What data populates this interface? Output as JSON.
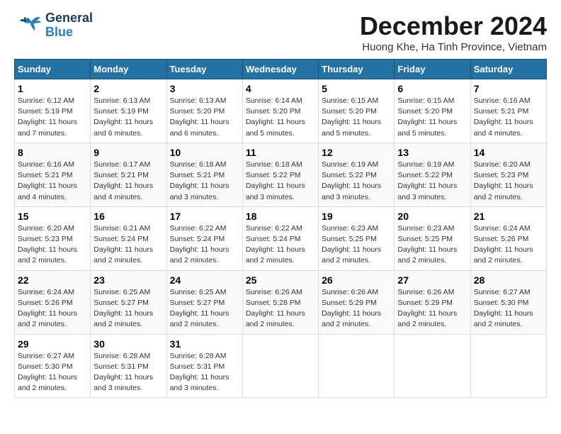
{
  "header": {
    "logo_general": "General",
    "logo_blue": "Blue",
    "title": "December 2024",
    "location": "Huong Khe, Ha Tinh Province, Vietnam"
  },
  "days_of_week": [
    "Sunday",
    "Monday",
    "Tuesday",
    "Wednesday",
    "Thursday",
    "Friday",
    "Saturday"
  ],
  "weeks": [
    [
      {
        "day": 1,
        "info": "Sunrise: 6:12 AM\nSunset: 5:19 PM\nDaylight: 11 hours\nand 7 minutes."
      },
      {
        "day": 2,
        "info": "Sunrise: 6:13 AM\nSunset: 5:19 PM\nDaylight: 11 hours\nand 6 minutes."
      },
      {
        "day": 3,
        "info": "Sunrise: 6:13 AM\nSunset: 5:20 PM\nDaylight: 11 hours\nand 6 minutes."
      },
      {
        "day": 4,
        "info": "Sunrise: 6:14 AM\nSunset: 5:20 PM\nDaylight: 11 hours\nand 5 minutes."
      },
      {
        "day": 5,
        "info": "Sunrise: 6:15 AM\nSunset: 5:20 PM\nDaylight: 11 hours\nand 5 minutes."
      },
      {
        "day": 6,
        "info": "Sunrise: 6:15 AM\nSunset: 5:20 PM\nDaylight: 11 hours\nand 5 minutes."
      },
      {
        "day": 7,
        "info": "Sunrise: 6:16 AM\nSunset: 5:21 PM\nDaylight: 11 hours\nand 4 minutes."
      }
    ],
    [
      {
        "day": 8,
        "info": "Sunrise: 6:16 AM\nSunset: 5:21 PM\nDaylight: 11 hours\nand 4 minutes."
      },
      {
        "day": 9,
        "info": "Sunrise: 6:17 AM\nSunset: 5:21 PM\nDaylight: 11 hours\nand 4 minutes."
      },
      {
        "day": 10,
        "info": "Sunrise: 6:18 AM\nSunset: 5:21 PM\nDaylight: 11 hours\nand 3 minutes."
      },
      {
        "day": 11,
        "info": "Sunrise: 6:18 AM\nSunset: 5:22 PM\nDaylight: 11 hours\nand 3 minutes."
      },
      {
        "day": 12,
        "info": "Sunrise: 6:19 AM\nSunset: 5:22 PM\nDaylight: 11 hours\nand 3 minutes."
      },
      {
        "day": 13,
        "info": "Sunrise: 6:19 AM\nSunset: 5:22 PM\nDaylight: 11 hours\nand 3 minutes."
      },
      {
        "day": 14,
        "info": "Sunrise: 6:20 AM\nSunset: 5:23 PM\nDaylight: 11 hours\nand 2 minutes."
      }
    ],
    [
      {
        "day": 15,
        "info": "Sunrise: 6:20 AM\nSunset: 5:23 PM\nDaylight: 11 hours\nand 2 minutes."
      },
      {
        "day": 16,
        "info": "Sunrise: 6:21 AM\nSunset: 5:24 PM\nDaylight: 11 hours\nand 2 minutes."
      },
      {
        "day": 17,
        "info": "Sunrise: 6:22 AM\nSunset: 5:24 PM\nDaylight: 11 hours\nand 2 minutes."
      },
      {
        "day": 18,
        "info": "Sunrise: 6:22 AM\nSunset: 5:24 PM\nDaylight: 11 hours\nand 2 minutes."
      },
      {
        "day": 19,
        "info": "Sunrise: 6:23 AM\nSunset: 5:25 PM\nDaylight: 11 hours\nand 2 minutes."
      },
      {
        "day": 20,
        "info": "Sunrise: 6:23 AM\nSunset: 5:25 PM\nDaylight: 11 hours\nand 2 minutes."
      },
      {
        "day": 21,
        "info": "Sunrise: 6:24 AM\nSunset: 5:26 PM\nDaylight: 11 hours\nand 2 minutes."
      }
    ],
    [
      {
        "day": 22,
        "info": "Sunrise: 6:24 AM\nSunset: 5:26 PM\nDaylight: 11 hours\nand 2 minutes."
      },
      {
        "day": 23,
        "info": "Sunrise: 6:25 AM\nSunset: 5:27 PM\nDaylight: 11 hours\nand 2 minutes."
      },
      {
        "day": 24,
        "info": "Sunrise: 6:25 AM\nSunset: 5:27 PM\nDaylight: 11 hours\nand 2 minutes."
      },
      {
        "day": 25,
        "info": "Sunrise: 6:26 AM\nSunset: 5:28 PM\nDaylight: 11 hours\nand 2 minutes."
      },
      {
        "day": 26,
        "info": "Sunrise: 6:26 AM\nSunset: 5:29 PM\nDaylight: 11 hours\nand 2 minutes."
      },
      {
        "day": 27,
        "info": "Sunrise: 6:26 AM\nSunset: 5:29 PM\nDaylight: 11 hours\nand 2 minutes."
      },
      {
        "day": 28,
        "info": "Sunrise: 6:27 AM\nSunset: 5:30 PM\nDaylight: 11 hours\nand 2 minutes."
      }
    ],
    [
      {
        "day": 29,
        "info": "Sunrise: 6:27 AM\nSunset: 5:30 PM\nDaylight: 11 hours\nand 2 minutes."
      },
      {
        "day": 30,
        "info": "Sunrise: 6:28 AM\nSunset: 5:31 PM\nDaylight: 11 hours\nand 3 minutes."
      },
      {
        "day": 31,
        "info": "Sunrise: 6:28 AM\nSunset: 5:31 PM\nDaylight: 11 hours\nand 3 minutes."
      },
      null,
      null,
      null,
      null
    ]
  ]
}
